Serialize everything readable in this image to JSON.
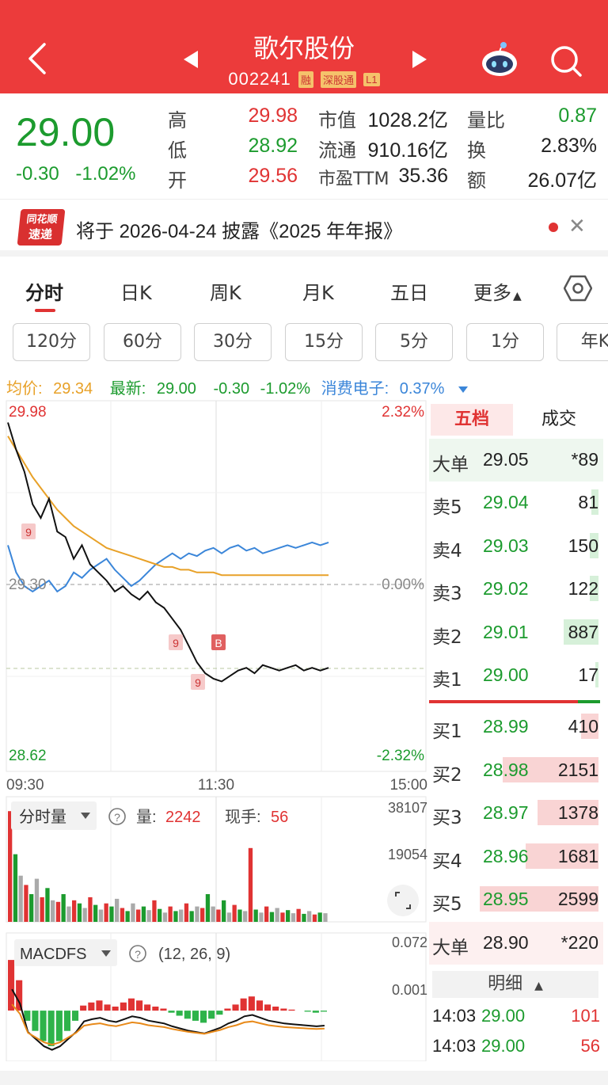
{
  "header": {
    "title": "歌尔股份",
    "code": "002241",
    "tags": [
      "融",
      "深股通",
      "L1"
    ]
  },
  "quote": {
    "price": "29.00",
    "change": "-0.30",
    "change_pct": "-1.02%",
    "high_label": "高",
    "high": "29.98",
    "low_label": "低",
    "low": "28.92",
    "open_label": "开",
    "open": "29.56",
    "mktcap_label": "市值",
    "mktcap": "1028.2亿",
    "float_label": "流通",
    "float": "910.16亿",
    "pe_label": "市盈TTM",
    "pe": "35.36",
    "vol_ratio_label": "量比",
    "vol_ratio": "0.87",
    "turnover_label": "换",
    "turnover": "2.83%",
    "amount_label": "额",
    "amount": "26.07亿"
  },
  "notice": {
    "logo_line1": "同花顺",
    "logo_line2": "速递",
    "text": "将于 2026-04-24 披露《2025 年年报》"
  },
  "tabs": [
    "分时",
    "日K",
    "周K",
    "月K",
    "五日",
    "更多"
  ],
  "periods": [
    "120分",
    "60分",
    "30分",
    "15分",
    "5分",
    "1分",
    "年K"
  ],
  "info": {
    "avg_label": "均价:",
    "avg": "29.34",
    "latest_label": "最新:",
    "latest": "29.00",
    "chg": "-0.30",
    "chg_pct": "-1.02%",
    "sector": "消费电子:",
    "sector_pct": "0.37%"
  },
  "chart_data": [
    {
      "type": "line",
      "title": "分时",
      "x_ticks": [
        "09:30",
        "11:30",
        "15:00"
      ],
      "y_left": {
        "top": "29.98",
        "mid": "29.30",
        "bottom": "28.62"
      },
      "y_right": {
        "top": "2.32%",
        "mid": "0.00%",
        "bottom": "-2.32%"
      },
      "ylim": [
        28.62,
        29.98
      ],
      "marker_labels": [
        "9",
        "9",
        "9",
        "B"
      ],
      "series": [
        {
          "name": "最新",
          "color": "#111111",
          "values": [
            29.9,
            29.8,
            29.72,
            29.6,
            29.55,
            29.62,
            29.5,
            29.48,
            29.4,
            29.45,
            29.38,
            29.35,
            29.32,
            29.28,
            29.3,
            29.27,
            29.25,
            29.28,
            29.24,
            29.22,
            29.18,
            29.14,
            29.08,
            29.02,
            28.98,
            28.96,
            28.95,
            28.97,
            28.99,
            29.0,
            28.98,
            29.01,
            29.0,
            28.99,
            29.0,
            29.01,
            28.99,
            29.0,
            28.99,
            29.0
          ]
        },
        {
          "name": "均价",
          "color": "#e8a128",
          "values": [
            29.85,
            29.8,
            29.75,
            29.7,
            29.66,
            29.62,
            29.58,
            29.55,
            29.52,
            29.5,
            29.48,
            29.46,
            29.44,
            29.43,
            29.42,
            29.41,
            29.4,
            29.39,
            29.38,
            29.37,
            29.37,
            29.36,
            29.36,
            29.35,
            29.35,
            29.35,
            29.34,
            29.34,
            29.34,
            29.34,
            29.34,
            29.34,
            29.34,
            29.34,
            29.34,
            29.34,
            29.34,
            29.34,
            29.34,
            29.34
          ]
        },
        {
          "name": "消费电子",
          "color": "#3b86d9",
          "values": [
            29.45,
            29.35,
            29.3,
            29.28,
            29.3,
            29.32,
            29.28,
            29.3,
            29.35,
            29.33,
            29.36,
            29.38,
            29.4,
            29.36,
            29.33,
            29.3,
            29.32,
            29.35,
            29.38,
            29.4,
            29.42,
            29.4,
            29.42,
            29.41,
            29.43,
            29.44,
            29.42,
            29.44,
            29.45,
            29.43,
            29.44,
            29.42,
            29.43,
            29.44,
            29.45,
            29.44,
            29.45,
            29.46,
            29.45,
            29.46
          ]
        }
      ]
    },
    {
      "type": "bar",
      "title": "分时量",
      "vol_label": "量:",
      "vol": "2242",
      "now_label": "现手:",
      "now": "56",
      "y_ticks": [
        "38107",
        "19054"
      ],
      "ylim": [
        0,
        38107
      ],
      "values": [
        36000,
        22000,
        15000,
        12000,
        9000,
        14000,
        8000,
        11000,
        7000,
        6500,
        9000,
        5000,
        7000,
        6000,
        4500,
        8000,
        5500,
        4000,
        6000,
        5000,
        7500,
        4500,
        3500,
        6000,
        4000,
        5000,
        3800,
        7000,
        4200,
        3000,
        5000,
        3500,
        4000,
        6000,
        3500,
        5000,
        4500,
        9000,
        5000,
        4000,
        7000,
        3000,
        5500,
        4000,
        3500,
        24000,
        4000,
        3000,
        5000,
        3200,
        4500,
        3000,
        3800,
        2800,
        4200,
        2600,
        3500,
        2400,
        3000,
        2800
      ]
    },
    {
      "type": "bar",
      "title": "MACDFS",
      "params": "(12, 26, 9)",
      "y_ticks": [
        "0.072",
        "0.001"
      ],
      "ylim": [
        -0.05,
        0.072
      ],
      "values": [
        0.05,
        0.03,
        -0.01,
        -0.02,
        -0.03,
        -0.035,
        -0.03,
        -0.02,
        -0.01,
        0.005,
        0.008,
        0.01,
        0.006,
        0.004,
        0.008,
        0.012,
        0.01,
        0.006,
        0.004,
        0.002,
        -0.002,
        -0.005,
        -0.008,
        -0.01,
        -0.012,
        -0.008,
        -0.004,
        0.002,
        0.006,
        0.012,
        0.014,
        0.01,
        0.006,
        0.004,
        0.002,
        0.001,
        0.0,
        -0.001,
        -0.002,
        -0.001
      ]
    }
  ],
  "volume_labels": {
    "title": "分时量"
  },
  "macd_labels": {
    "title": "MACDFS"
  },
  "book": {
    "tab_active": "五档",
    "tab_other": "成交",
    "big_sell": {
      "label": "大单",
      "price": "29.05",
      "vol": "*89"
    },
    "asks": [
      {
        "label": "卖5",
        "price": "29.04",
        "vol": "81",
        "bar": 0.04
      },
      {
        "label": "卖4",
        "price": "29.03",
        "vol": "150",
        "bar": 0.05
      },
      {
        "label": "卖3",
        "price": "29.02",
        "vol": "122",
        "bar": 0.05
      },
      {
        "label": "卖2",
        "price": "29.01",
        "vol": "887",
        "bar": 0.2
      },
      {
        "label": "卖1",
        "price": "29.00",
        "vol": "17",
        "bar": 0.02
      }
    ],
    "bids": [
      {
        "label": "买1",
        "price": "28.99",
        "vol": "410",
        "bar": 0.1
      },
      {
        "label": "买2",
        "price": "28.98",
        "vol": "2151",
        "bar": 0.55
      },
      {
        "label": "买3",
        "price": "28.97",
        "vol": "1378",
        "bar": 0.35
      },
      {
        "label": "买4",
        "price": "28.96",
        "vol": "1681",
        "bar": 0.42
      },
      {
        "label": "买5",
        "price": "28.95",
        "vol": "2599",
        "bar": 0.68
      }
    ],
    "big_buy": {
      "label": "大单",
      "price": "28.90",
      "vol": "*220"
    },
    "detail_label": "明细",
    "trades": [
      {
        "time": "14:03",
        "price": "29.00",
        "vol": "101"
      },
      {
        "time": "14:03",
        "price": "29.00",
        "vol": "56"
      }
    ]
  }
}
